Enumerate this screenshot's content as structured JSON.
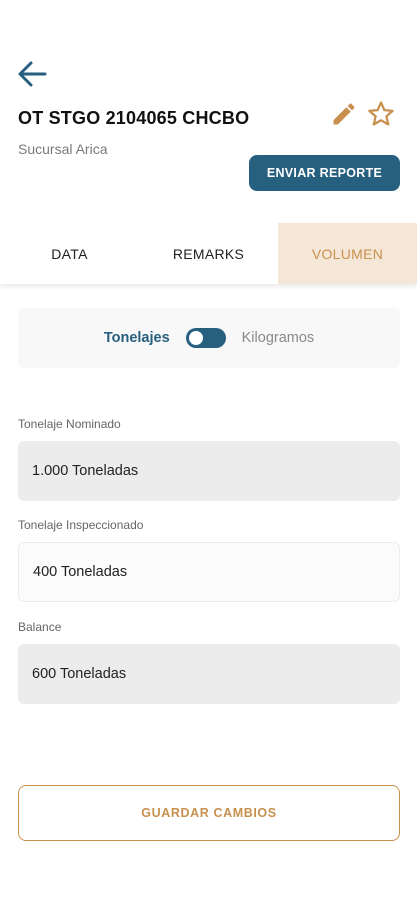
{
  "header": {
    "title": "OT STGO 2104065 CHCBO",
    "subtitle": "Sucursal Arica",
    "report_button": "ENVIAR REPORTE"
  },
  "tabs": [
    {
      "label": "DATA",
      "active": false
    },
    {
      "label": "REMARKS",
      "active": false
    },
    {
      "label": "VOLUMEN",
      "active": true
    }
  ],
  "unit_toggle": {
    "left_label": "Tonelajes",
    "right_label": "Kilogramos",
    "selected": "Tonelajes"
  },
  "fields": {
    "nominal": {
      "label": "Tonelaje Nominado",
      "value": "1.000 Toneladas"
    },
    "inspected": {
      "label": "Tonelaje Inspeccionado",
      "value": "400 Toneladas"
    },
    "balance": {
      "label": "Balance",
      "value": "600 Toneladas"
    }
  },
  "save_button": "GUARDAR CAMBIOS",
  "colors": {
    "primary": "#275f7e",
    "accent": "#c8904f",
    "active_tab_bg": "#f5e7d8"
  },
  "icons": [
    "arrow-back-icon",
    "edit-pencil-icon",
    "star-outline-icon"
  ]
}
